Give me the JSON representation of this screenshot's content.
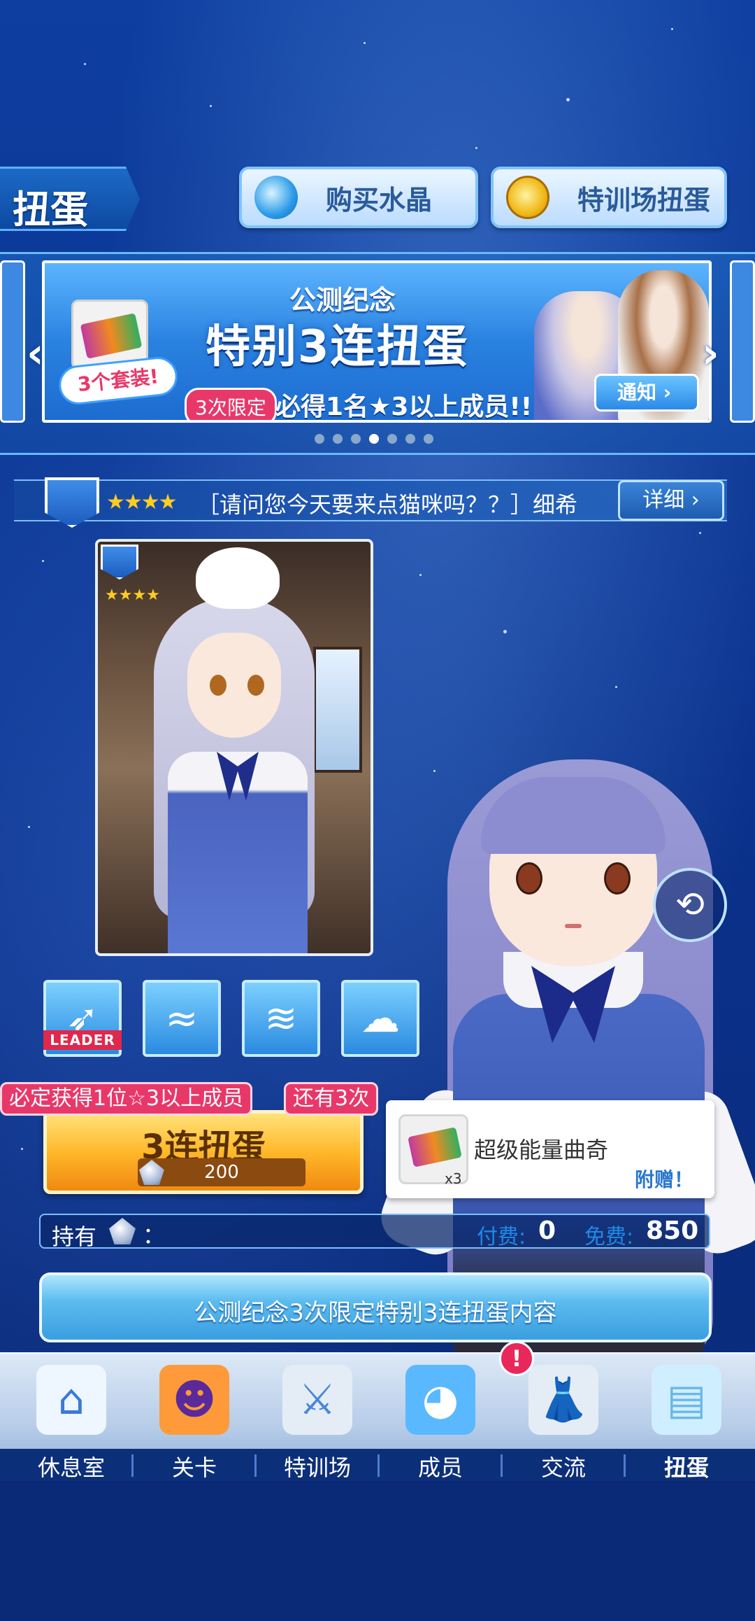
{
  "header": {
    "title": "扭蛋",
    "buy_crystal_label": "购买水晶",
    "training_gacha_label": "特训场扭蛋"
  },
  "banner": {
    "subtitle": "公测纪念",
    "title": "特别3连扭蛋",
    "limit_tag": "3次限定",
    "guarantee": "必得1名★3以上成员!!",
    "set_tag": "3个套装!",
    "notice_label": "通知",
    "page_count": 7,
    "active_page": 4
  },
  "card": {
    "rarity_stars": "★★★★",
    "name": "［请问您今天要来点猫咪吗？？］细希",
    "detail_label": "详细"
  },
  "skills": {
    "leader_tag": "LEADER"
  },
  "gacha": {
    "guarantee_tag": "必定获得1位☆3以上成员",
    "remaining_tag": "还有3次",
    "button_label": "3连扭蛋",
    "cost": "200"
  },
  "bonus": {
    "item_name": "超级能量曲奇",
    "quantity": "x3",
    "gift_label": "附赠！"
  },
  "holdings": {
    "label": "持有",
    "colon": "：",
    "paid_label": "付费:",
    "paid_value": "0",
    "free_label": "免费:",
    "free_value": "850"
  },
  "content_button": "公测纪念3次限定特别3连扭蛋内容",
  "nav": {
    "items": [
      {
        "label": "休息室",
        "icon": "school-building-icon"
      },
      {
        "label": "关卡",
        "icon": "orange-demon-icon"
      },
      {
        "label": "特训场",
        "icon": "crossed-swords-icon"
      },
      {
        "label": "成员",
        "icon": "blue-cat-member-icon"
      },
      {
        "label": "交流",
        "icon": "uniform-dress-icon"
      },
      {
        "label": "扭蛋",
        "icon": "curtain-gacha-icon"
      }
    ],
    "notification_badge": "!"
  },
  "colors": {
    "accent_blue": "#2a82e0",
    "gacha_orange": "#ffb82a",
    "tag_pink": "#e8386a",
    "nav_bg": "#b6cce8"
  }
}
